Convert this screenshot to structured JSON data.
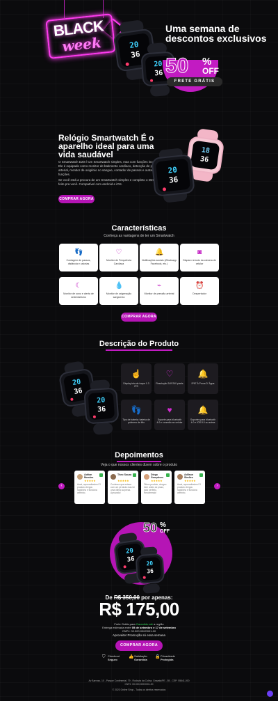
{
  "hero": {
    "sign_top": "BLACK",
    "sign_bottom": "week",
    "title": "Uma semana de descontos exclusivos",
    "discount": "50",
    "pct_sign": "%",
    "off": "OFF",
    "free_shipping": "FRETE GRÁTIS"
  },
  "watch_screens": {
    "time_hour": "20",
    "time_min": "36",
    "pink_hour": "18",
    "pink_min": "36"
  },
  "intro": {
    "title": "Relógio Smartwatch É o aparelho ideal para uma vida saudável",
    "p1": "O Smartwatch D20 é um Smartwatch simples, mas com funções incríveis. Ele é equipado como monitor de batimento cardíaco, detecção de pressão arterial, monitor de oxigênio no sangue, contador de passos e outras funções.",
    "p2": "Se você está a procura de um Smartwatch simples e completo o D20 foi feito pra você. Compatível com android e iOS.",
    "cta": "COMPRAR AGORA"
  },
  "features": {
    "title": "Características",
    "subtitle": "Conheça as vantagens de ter um Smartwatch",
    "items": [
      {
        "label": "Contagem de passos, distância e calorias",
        "icon": "footprints-icon"
      },
      {
        "label": "Monitor de Frequência Cardíaca",
        "icon": "heart-rate-icon"
      },
      {
        "label": "Notificações sociais (Whatsapp Facebook, etc.)",
        "icon": "bell-icon"
      },
      {
        "label": "Disparo remoto da câmera de celular",
        "icon": "camera-icon"
      },
      {
        "label": "Monitor de sono e alerta de sedentarismo",
        "icon": "sleep-icon"
      },
      {
        "label": "Monitor de oxigenação sanguínea",
        "icon": "droplet-icon"
      },
      {
        "label": "Monitor de pressão arterial",
        "icon": "pressure-icon"
      },
      {
        "label": "Despertador",
        "icon": "alarm-icon"
      }
    ],
    "cta": "COMPRAR AGORA"
  },
  "description": {
    "title": "Descrição do Produto",
    "items": [
      {
        "label": "Display tela de toque 1.3 IPS",
        "icon": "touch-icon"
      },
      {
        "label": "Resolução 240*240 pixels",
        "icon": "heart-rate-icon"
      },
      {
        "label": "IP67 À Prova D' Água",
        "icon": "bell-icon"
      },
      {
        "label": "Tipo de bateria: bateria de polímero de lítio",
        "icon": "footprints-icon"
      },
      {
        "label": "Suporte para bluetooth 4.0 e conexão ao celular",
        "icon": "heart-icon"
      },
      {
        "label": "Suportes para bluetooth 4.0 e IOS 8.0 ou acima",
        "icon": "bell-icon"
      }
    ]
  },
  "testimonials": {
    "title": "Depoimentos",
    "subtitle": "Veja o que nossos clientes dizem sobre o produto",
    "stars": "★★★★★",
    "items": [
      {
        "name": "Adrian Mendes",
        "text": "Amei, aprovadíssimo! O produto chegou rapidinho e funciona certinho."
      },
      {
        "name": "Theo Souza",
        "text": "Confesso que estava com um pé atrás mas foi uma ótima surpresa. Aprovado!"
      },
      {
        "name": "Diego Gonçalves",
        "text": "Ótimo produto, chegou bem antes do prazo, tudo perfeito. Recomendo!"
      },
      {
        "name": "Adilson Simões",
        "text": "Amei, aprovadíssimo! O produto chegou rapidinho e funciona certinho."
      }
    ]
  },
  "offer": {
    "discount": "50",
    "pct_sign": "%",
    "off": "OFF",
    "from_label": "De",
    "old_price": "R$ 350,00",
    "for_label": "por apenas:",
    "price": "R$ 175,00",
    "line1_a": "Frete Grátis para",
    "line1_green": "Garantido até",
    "line1_b": "a região",
    "line2_a": "Entrega estimada entre",
    "line2_b": "05 de setembro e 17 de setembro",
    "line3": "CNPJ: 00.000.000/0001-00",
    "hurry": "Aproveite! Promoção só essa semana",
    "cta": "COMPRAR AGORA",
    "trust": [
      {
        "l1": "Checkout",
        "l2": "Seguro",
        "icon": "shield-icon"
      },
      {
        "l1": "Satisfação",
        "l2": "Garantida",
        "icon": "thumbs-up-icon"
      },
      {
        "l1": "Privacidade",
        "l2": "Protegida",
        "icon": "lock-icon"
      }
    ]
  },
  "footer": {
    "address": "Av Barroso, 10 - Parque Continental, 79 - Rodovia da Colina, Gravatá/PE - 55 - CEP: 55641-000",
    "cnpj": "CNPJ: 00.000.000/0001-00",
    "copyright": "© 2023 Online Shop - Todos os direitos reservados"
  },
  "colors": {
    "accent": "#c21bc2",
    "background": "#0b0b0d",
    "card": "#ffffff",
    "dark_card": "#1d1b20"
  }
}
